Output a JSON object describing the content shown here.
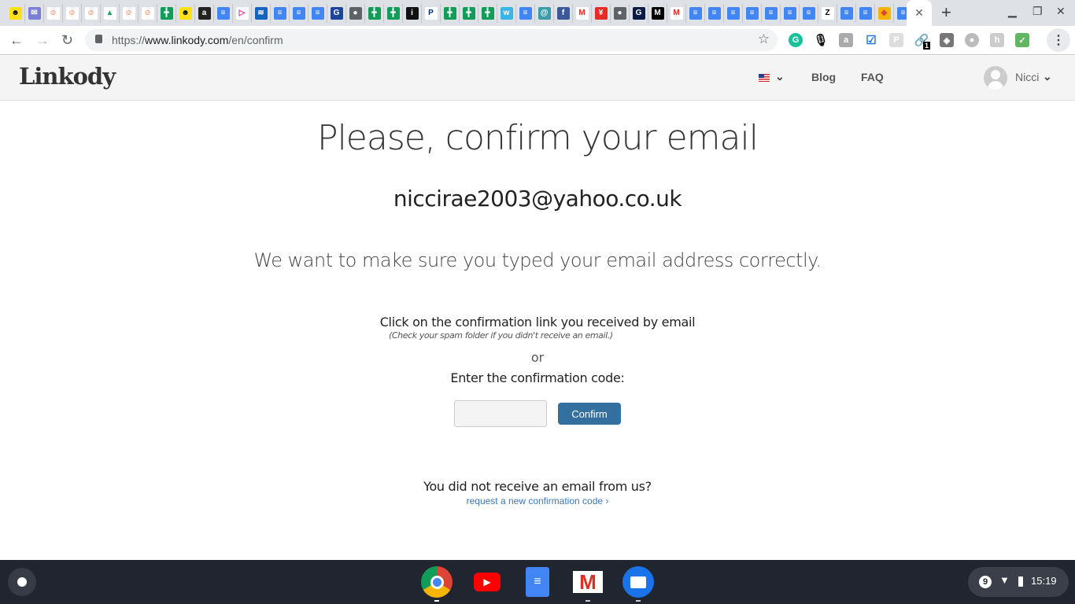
{
  "browser": {
    "pinned_tabs": [
      {
        "icon": "mailchimp-icon",
        "bg": "#ffe01b",
        "fg": "#000",
        "g": "☻"
      },
      {
        "icon": "mail-icon",
        "bg": "#7b7fd6",
        "fg": "#fff",
        "g": "✉"
      },
      {
        "icon": "reddit-alien-icon",
        "bg": "#fff",
        "fg": "#ff4500",
        "g": "☺"
      },
      {
        "icon": "reddit-alien-icon",
        "bg": "#fff",
        "fg": "#ff4500",
        "g": "☺"
      },
      {
        "icon": "reddit-alien-icon",
        "bg": "#fff",
        "fg": "#ff4500",
        "g": "☺"
      },
      {
        "icon": "google-drive-icon",
        "bg": "#fff",
        "fg": "#1fa463",
        "g": "▲"
      },
      {
        "icon": "reddit-alien-icon",
        "bg": "#fff",
        "fg": "#ff4500",
        "g": "☺"
      },
      {
        "icon": "reddit-alien-icon",
        "bg": "#fff",
        "fg": "#ff4500",
        "g": "☺"
      },
      {
        "icon": "google-sheets-icon",
        "bg": "#0f9d58",
        "fg": "#fff",
        "g": "╋"
      },
      {
        "icon": "mailchimp-icon",
        "bg": "#ffe01b",
        "fg": "#000",
        "g": "☻"
      },
      {
        "icon": "amazon-icon",
        "bg": "#222",
        "fg": "#fff",
        "g": "a"
      },
      {
        "icon": "google-docs-icon",
        "bg": "#4285f4",
        "fg": "#fff",
        "g": "≡"
      },
      {
        "icon": "play-icon",
        "bg": "#fff",
        "fg": "#e91e8c",
        "g": "▷"
      },
      {
        "icon": "bank-icon",
        "bg": "#1565c0",
        "fg": "#fff",
        "g": "≋"
      },
      {
        "icon": "google-docs-icon",
        "bg": "#4285f4",
        "fg": "#fff",
        "g": "≡"
      },
      {
        "icon": "google-docs-icon",
        "bg": "#4285f4",
        "fg": "#fff",
        "g": "≡"
      },
      {
        "icon": "google-docs-icon",
        "bg": "#4285f4",
        "fg": "#fff",
        "g": "≡"
      },
      {
        "icon": "gmx-icon",
        "bg": "#1c449b",
        "fg": "#fff",
        "g": "G"
      },
      {
        "icon": "globe-icon",
        "bg": "#5f6368",
        "fg": "#fff",
        "g": "●"
      },
      {
        "icon": "google-sheets-icon",
        "bg": "#0f9d58",
        "fg": "#fff",
        "g": "╋"
      },
      {
        "icon": "google-sheets-icon",
        "bg": "#0f9d58",
        "fg": "#fff",
        "g": "╋"
      },
      {
        "icon": "itv-icon",
        "bg": "#111",
        "fg": "#fff",
        "g": "i"
      },
      {
        "icon": "paypal-icon",
        "bg": "#fff",
        "fg": "#003087",
        "g": "P"
      },
      {
        "icon": "google-sheets-icon",
        "bg": "#0f9d58",
        "fg": "#fff",
        "g": "╋"
      },
      {
        "icon": "google-sheets-icon",
        "bg": "#0f9d58",
        "fg": "#fff",
        "g": "╋"
      },
      {
        "icon": "google-sheets-icon",
        "bg": "#0f9d58",
        "fg": "#fff",
        "g": "╋"
      },
      {
        "icon": "wix-icon",
        "bg": "#3ab4e6",
        "fg": "#fff",
        "g": "w"
      },
      {
        "icon": "google-docs-icon",
        "bg": "#4285f4",
        "fg": "#fff",
        "g": "≡"
      },
      {
        "icon": "swirl-icon",
        "bg": "#3a9ca8",
        "fg": "#fff",
        "g": "@"
      },
      {
        "icon": "facebook-icon",
        "bg": "#3b5998",
        "fg": "#fff",
        "g": "f"
      },
      {
        "icon": "gmail-icon",
        "bg": "#fff",
        "fg": "#d93025",
        "g": "M"
      },
      {
        "icon": "yen-icon",
        "bg": "#e52d27",
        "fg": "#fff",
        "g": "¥"
      },
      {
        "icon": "globe-icon",
        "bg": "#5f6368",
        "fg": "#fff",
        "g": "●"
      },
      {
        "icon": "gap-icon",
        "bg": "#0a1b44",
        "fg": "#fff",
        "g": "G"
      },
      {
        "icon": "marks-spencer-icon",
        "bg": "#000",
        "fg": "#fff",
        "g": "M"
      },
      {
        "icon": "gmail-icon",
        "bg": "#fff",
        "fg": "#d93025",
        "g": "M"
      },
      {
        "icon": "google-docs-icon",
        "bg": "#4285f4",
        "fg": "#fff",
        "g": "≡"
      },
      {
        "icon": "google-docs-icon",
        "bg": "#4285f4",
        "fg": "#fff",
        "g": "≡"
      },
      {
        "icon": "google-docs-icon",
        "bg": "#4285f4",
        "fg": "#fff",
        "g": "≡"
      },
      {
        "icon": "google-docs-icon",
        "bg": "#4285f4",
        "fg": "#fff",
        "g": "≡"
      },
      {
        "icon": "google-docs-icon",
        "bg": "#4285f4",
        "fg": "#fff",
        "g": "≡"
      },
      {
        "icon": "google-docs-icon",
        "bg": "#4285f4",
        "fg": "#fff",
        "g": "≡"
      },
      {
        "icon": "google-docs-icon",
        "bg": "#4285f4",
        "fg": "#fff",
        "g": "≡"
      },
      {
        "icon": "zara-icon",
        "bg": "#fff",
        "fg": "#000",
        "g": "Z"
      },
      {
        "icon": "google-docs-icon",
        "bg": "#4285f4",
        "fg": "#fff",
        "g": "≡"
      },
      {
        "icon": "google-docs-icon",
        "bg": "#4285f4",
        "fg": "#fff",
        "g": "≡"
      },
      {
        "icon": "colorful-squares-icon",
        "bg": "#f4b400",
        "fg": "#db4437",
        "g": "◆"
      },
      {
        "icon": "google-docs-icon",
        "bg": "#4285f4",
        "fg": "#fff",
        "g": "≡"
      }
    ],
    "url_prefix": "https://",
    "url_host": "www.linkody.com",
    "url_path": "/en/confirm",
    "extension_badge": "1"
  },
  "site": {
    "logo": "Linkody",
    "nav": {
      "blog": "Blog",
      "faq": "FAQ",
      "user": "Nicci"
    },
    "accent": "#34709f"
  },
  "main": {
    "title": "Please, confirm your email",
    "email": "niccirae2003@yahoo.co.uk",
    "subtitle": "We want to make sure you typed your email address correctly.",
    "click_text": "Click on the confirmation link you received by email",
    "spam_note": "(Check your spam folder if you didn't receive an email.)",
    "or": "or",
    "enter_code": "Enter the confirmation code:",
    "code_value": "",
    "confirm_label": "Confirm",
    "no_email": "You did not receive an email from us?",
    "request_link": "request a new confirmation code ›"
  },
  "shelf": {
    "notifications": "9",
    "time": "15:19"
  }
}
